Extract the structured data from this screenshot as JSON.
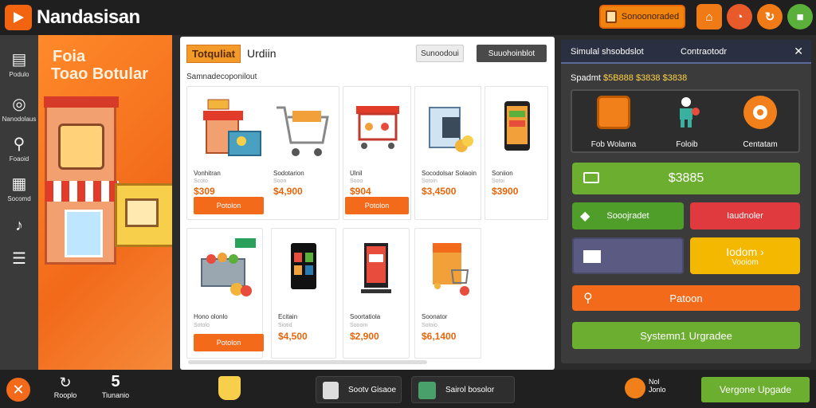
{
  "topbar": {
    "app_title": "Nandasisan",
    "action_label": "Sonoonoraded",
    "circle_icons": [
      "storefront-icon",
      "bag-icon",
      "refresh-icon",
      "square-icon"
    ]
  },
  "rail": {
    "items": [
      {
        "label": "Podulo",
        "icon": "clapper-icon"
      },
      {
        "label": "Nanodolaus",
        "icon": "compass-icon"
      },
      {
        "label": "Foaoid",
        "icon": "search-icon"
      },
      {
        "label": "Socomd",
        "icon": "chart-icon"
      },
      {
        "label": "",
        "icon": "guitar-icon"
      },
      {
        "label": "",
        "icon": "list-icon"
      }
    ]
  },
  "promo": {
    "line1": "Foia",
    "line2": "Toao Botular"
  },
  "main": {
    "tag": "Totquliat",
    "heading": "Urdiin",
    "btn_light": "Sunoodoui",
    "btn_dark": "Suuohoinblot",
    "subheading": "Samnadecoponilout",
    "products": [
      {
        "name": "Vonhitran",
        "sub": "Scoto",
        "price": "$309",
        "button": "Potolon"
      },
      {
        "name": "Sodotarion",
        "sub": "Soon",
        "price": "$4,900",
        "button": ""
      },
      {
        "name": "Ulnil",
        "sub": "Sooo",
        "price": "$904",
        "button": "Potolon"
      },
      {
        "name": "Socodolsar Solaoin",
        "sub": "Sotoin",
        "price": "$3,4500",
        "button": ""
      },
      {
        "name": "Soniion",
        "sub": "Sotoi",
        "price": "$3900",
        "button": ""
      },
      {
        "name": "Hono olonlo",
        "sub": "Sotolo",
        "price": "",
        "button": "Potolon"
      },
      {
        "name": "Ecitain",
        "sub": "Siotid",
        "price": "$4,500",
        "button": ""
      },
      {
        "name": "Soortatiola",
        "sub": "Sooom",
        "price": "$2,900",
        "button": ""
      },
      {
        "name": "Soonator",
        "sub": "Sotoio",
        "price": "$6,1400",
        "button": ""
      }
    ]
  },
  "right": {
    "header_a": "Simulal shsobdslot",
    "header_b": "Contraotodr",
    "status_label": "Spadmt",
    "status_value": "$5B888 $3838 $3838",
    "tools": [
      {
        "label": "Fob Wolama",
        "icon": "notepad-icon"
      },
      {
        "label": "Foloib",
        "icon": "worker-icon"
      },
      {
        "label": "Centatam",
        "icon": "gear-icon"
      }
    ],
    "btn_primary": "$3885",
    "btn_secondary_left": "Sooojradet",
    "btn_secondary_right": "Iaudnoler",
    "btn_purple": "",
    "btn_yellow_line1": "Iodom ›",
    "btn_yellow_line2": "Vooiom",
    "btn_orange": "Patoon",
    "btn_upgrade": "Systemn1 Urgradee"
  },
  "bottombar": {
    "left_label": "Rooplo",
    "number": "5",
    "number_label": "Tiunanio",
    "pill1": "Sootv Gisaoe",
    "pill2": "Sairol bosolor",
    "right_label_1": "Nol",
    "right_label_2": "Jonlo",
    "upgrade_button": "Vergone Upgade"
  },
  "colors": {
    "accent_orange": "#f26a1a",
    "accent_green": "#6cae2f",
    "accent_red": "#e03a3e",
    "accent_purple": "#5a5a82",
    "accent_yellow": "#f5b800",
    "price": "#e8650a"
  }
}
